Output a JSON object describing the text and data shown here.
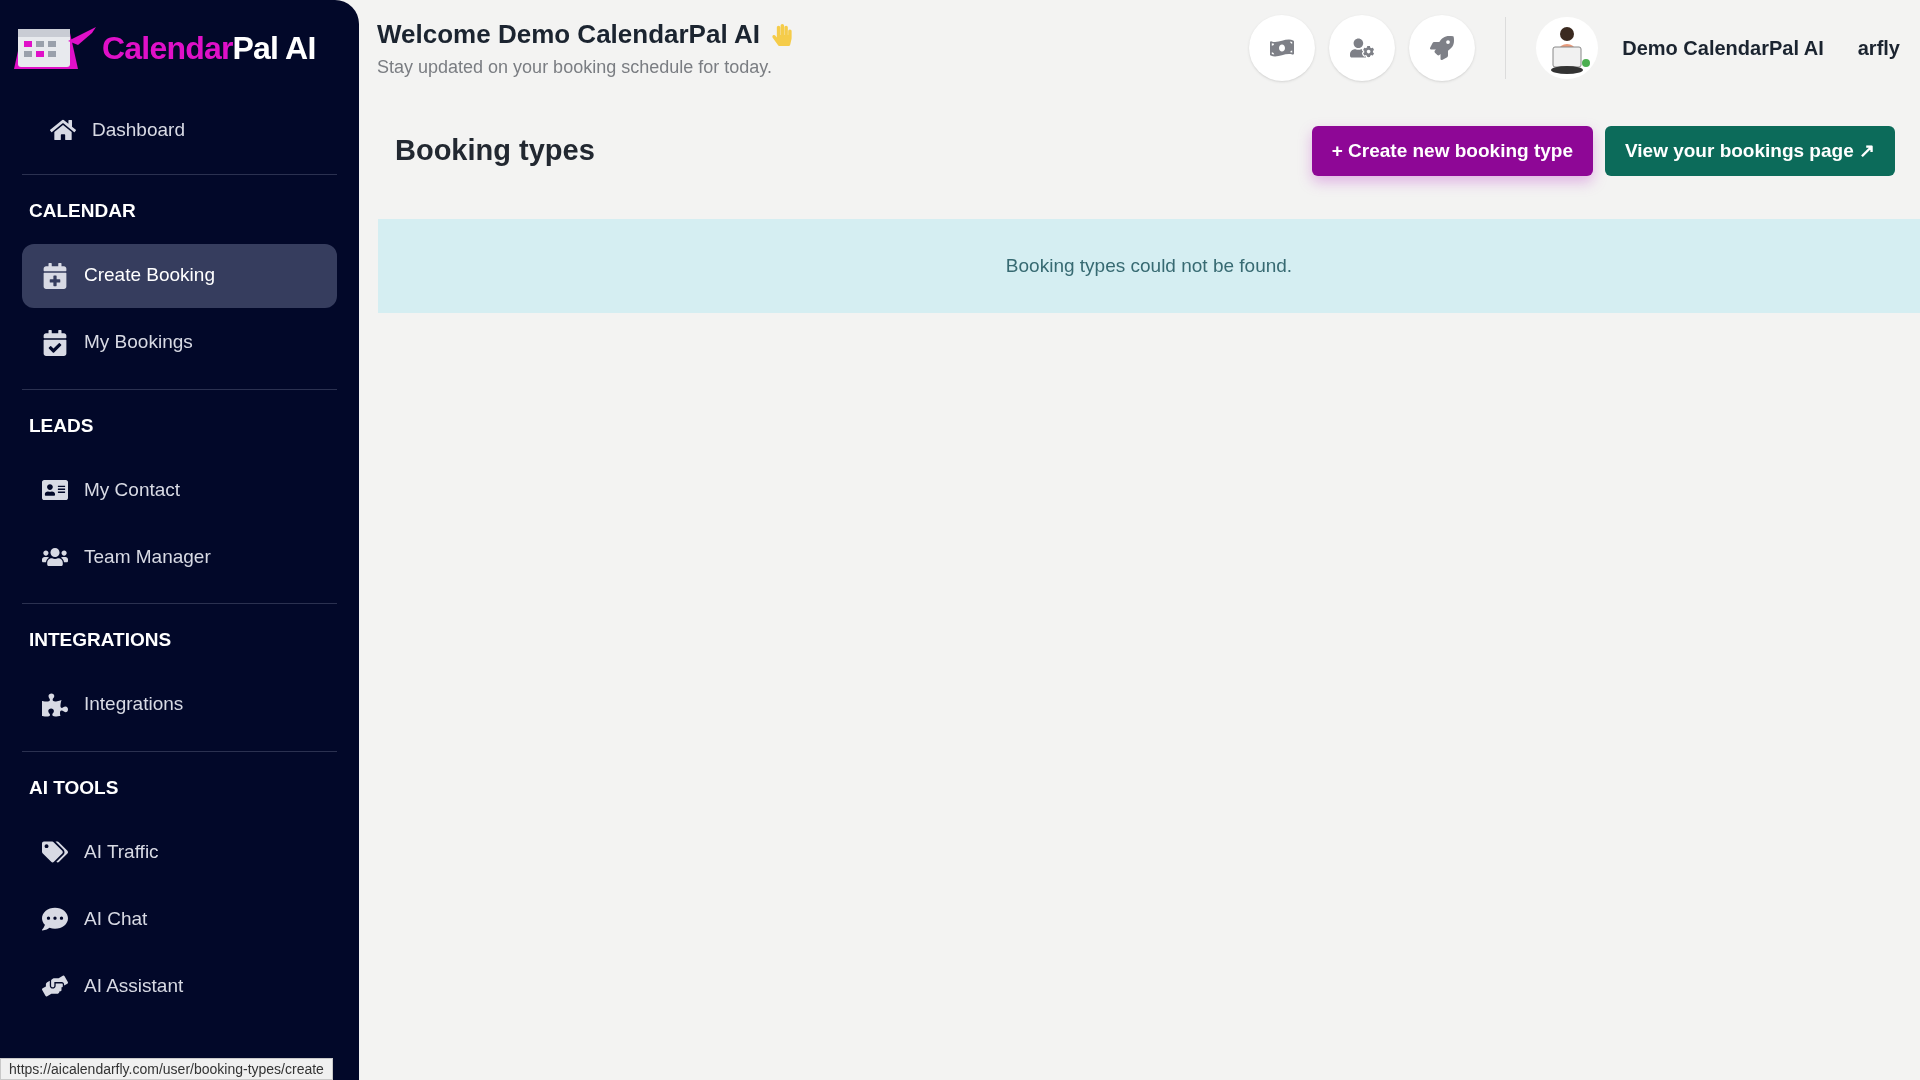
{
  "logo": {
    "brand": "Calendar",
    "suffix": "Pal AI"
  },
  "sidebar": {
    "top_item": {
      "label": "Dashboard",
      "selected": false
    },
    "sections": [
      {
        "heading": "CALENDAR",
        "items": [
          {
            "label": "Create Booking",
            "selected": true
          },
          {
            "label": "My Bookings",
            "selected": false
          }
        ]
      },
      {
        "heading": "LEADS",
        "items": [
          {
            "label": "My Contact",
            "selected": false
          },
          {
            "label": "Team Manager",
            "selected": false
          }
        ]
      },
      {
        "heading": "INTEGRATIONS",
        "items": [
          {
            "label": "Integrations",
            "selected": false
          }
        ]
      },
      {
        "heading": "AI TOOLS",
        "items": [
          {
            "label": "AI Traffic",
            "selected": false
          },
          {
            "label": "AI Chat",
            "selected": false
          },
          {
            "label": "AI Assistant",
            "selected": false
          }
        ]
      }
    ]
  },
  "header": {
    "title": "Welcome Demo CalendarPal AI",
    "subtitle": "Stay updated on your booking schedule for today.",
    "user_name": "Demo CalendarPal AI",
    "cut_text": "arfly"
  },
  "page": {
    "title": "Booking types",
    "buttons": [
      {
        "label": "+ Create new booking type",
        "kind": "primary"
      },
      {
        "label": "View your bookings page ↗",
        "kind": "secondary"
      }
    ],
    "alert": "Booking types could not be found."
  },
  "status_bar": {
    "url": "https://aicalendarfly.com/user/booking-types/create"
  }
}
